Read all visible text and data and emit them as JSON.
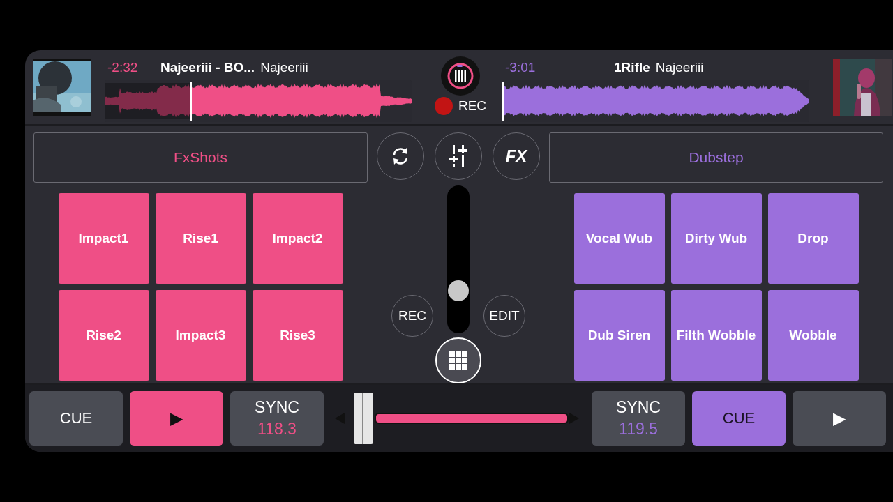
{
  "decks": [
    {
      "color": "#ef4f86",
      "time": "-2:32",
      "title": "Najeeriii - BO...",
      "artist": "Najeeriii",
      "level": 0.28,
      "bank": "FxShots",
      "pads": [
        "Impact1",
        "Rise1",
        "Impact2",
        "Rise2",
        "Impact3",
        "Rise3"
      ],
      "transport": [
        {
          "kind": "cue",
          "label": "CUE",
          "active": false
        },
        {
          "kind": "play",
          "label": "▶",
          "active": true
        },
        {
          "kind": "sync",
          "label": "SYNC",
          "bpm": "118.3",
          "active": false
        }
      ]
    },
    {
      "color": "#9b6fdc",
      "time": "-3:01",
      "title": "1Rifle",
      "artist": "Najeeriii",
      "level": 0.0,
      "bank": "Dubstep",
      "pads": [
        "Vocal Wub",
        "Dirty Wub",
        "Drop",
        "Dub Siren",
        "Filth Wobble",
        "Wobble"
      ],
      "transport": [
        {
          "kind": "sync",
          "label": "SYNC",
          "bpm": "119.5",
          "active": false
        },
        {
          "kind": "cue",
          "label": "CUE",
          "active": true
        },
        {
          "kind": "play",
          "label": "▶",
          "active": false
        }
      ]
    }
  ],
  "mixer": {
    "rec_label": "REC",
    "tools": [
      {
        "kind": "sync"
      },
      {
        "kind": "mixer"
      },
      {
        "kind": "fx",
        "label": "FX"
      }
    ],
    "side_buttons": [
      "REC",
      "EDIT"
    ],
    "volume": {
      "level": 0.25
    },
    "crossfader": {
      "level": 0.04
    }
  }
}
